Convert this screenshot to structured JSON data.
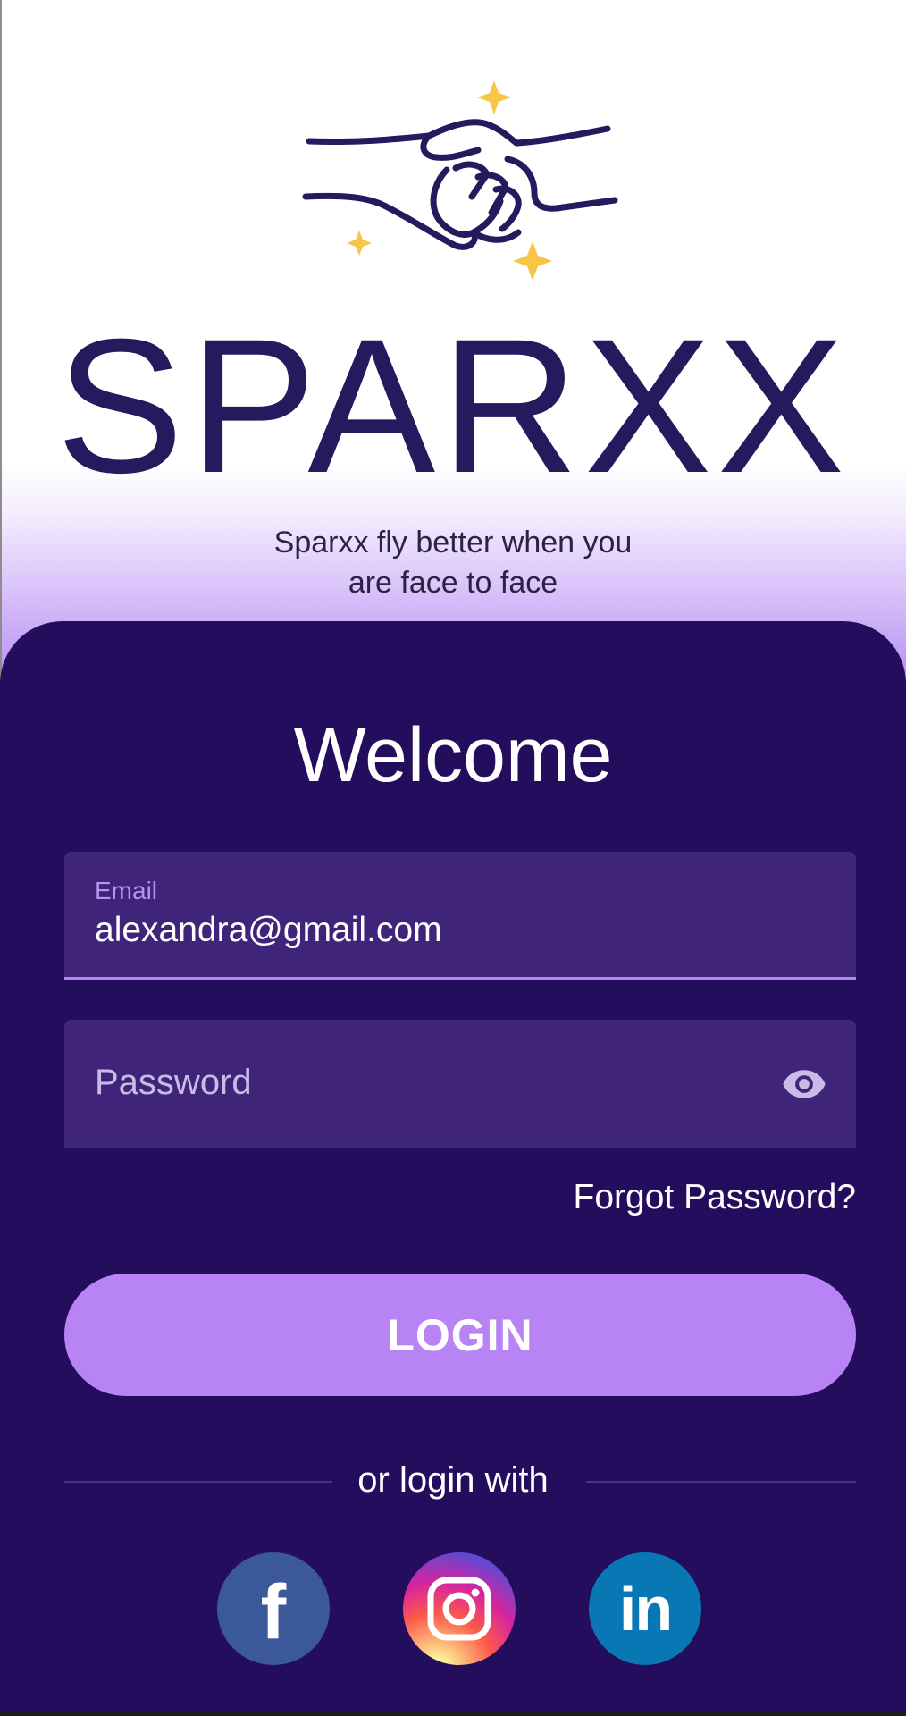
{
  "brand": {
    "name": "SPARXX",
    "tagline_line1": "Sparxx fly better when you",
    "tagline_line2": "are face to face",
    "logo_icon": "handshake-icon"
  },
  "login": {
    "title": "Welcome",
    "email_label": "Email",
    "email_value": "alexandra@gmail.com",
    "password_placeholder": "Password",
    "password_toggle_icon": "eye-icon",
    "forgot_label": "Forgot Password?",
    "submit_label": "LOGIN",
    "divider_text": "or login with"
  },
  "social": [
    {
      "icon": "facebook-icon",
      "glyph": "f",
      "color": "#3b5998"
    },
    {
      "icon": "instagram-icon",
      "color": "#d6249f"
    },
    {
      "icon": "linkedin-icon",
      "glyph": "in",
      "color": "#0a77b5"
    }
  ],
  "colors": {
    "panel": "#250d5e",
    "field": "#40247a",
    "accent": "#b883f5",
    "brand_text": "#26195e",
    "star": "#f7c548"
  }
}
